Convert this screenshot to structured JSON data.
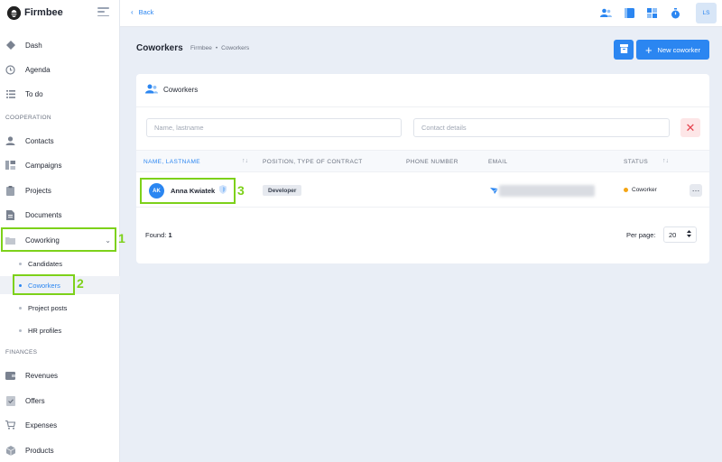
{
  "app": {
    "name": "Firmbee",
    "logo_icon": "firmbee-bee-icon"
  },
  "topbar": {
    "back_label": "Back",
    "icons": [
      "users-icon",
      "panel-icon",
      "grid-icon",
      "stopwatch-icon"
    ],
    "avatar_initials": "LS"
  },
  "sidebar": {
    "items_top": [
      {
        "label": "Dash",
        "icon": "dash-icon"
      },
      {
        "label": "Agenda",
        "icon": "clock-icon"
      },
      {
        "label": "To do",
        "icon": "list-icon"
      }
    ],
    "section_cooperation": "COOPERATION",
    "items_coop": [
      {
        "label": "Contacts",
        "icon": "contact-icon"
      },
      {
        "label": "Campaigns",
        "icon": "campaign-icon"
      },
      {
        "label": "Projects",
        "icon": "clipboard-icon"
      },
      {
        "label": "Documents",
        "icon": "document-icon"
      },
      {
        "label": "Coworking",
        "icon": "folder-icon"
      }
    ],
    "coworking_sub": [
      {
        "label": "Candidates"
      },
      {
        "label": "Coworkers"
      },
      {
        "label": "Project posts"
      },
      {
        "label": "HR profiles"
      }
    ],
    "section_finances": "FINANCES",
    "items_fin": [
      {
        "label": "Revenues",
        "icon": "wallet-icon"
      },
      {
        "label": "Offers",
        "icon": "offer-icon"
      },
      {
        "label": "Expenses",
        "icon": "cart-icon"
      },
      {
        "label": "Products",
        "icon": "box-icon"
      }
    ]
  },
  "annotations": [
    "1",
    "2",
    "3"
  ],
  "page": {
    "title": "Coworkers",
    "breadcrumb": [
      "Firmbee",
      "•",
      "Coworkers"
    ],
    "new_button_label": "New coworker"
  },
  "card": {
    "title": "Coworkers",
    "filter_name_placeholder": "Name, lastname",
    "filter_contact_placeholder": "Contact details",
    "columns": [
      "NAME, LASTNAME",
      "POSITION, TYPE OF CONTRACT",
      "PHONE NUMBER",
      "EMAIL",
      "STATUS"
    ],
    "rows": [
      {
        "initials": "AK",
        "name": "Anna Kwiatek",
        "position": "Developer",
        "phone": "",
        "status": "Coworker",
        "status_color": "#f4a515"
      }
    ],
    "found_label": "Found:",
    "found_count": "1",
    "per_page_label": "Per page:",
    "per_page_value": "20"
  },
  "colors": {
    "accent": "#2b86f1",
    "highlight": "#7dd11a",
    "danger": "#e5444f"
  }
}
